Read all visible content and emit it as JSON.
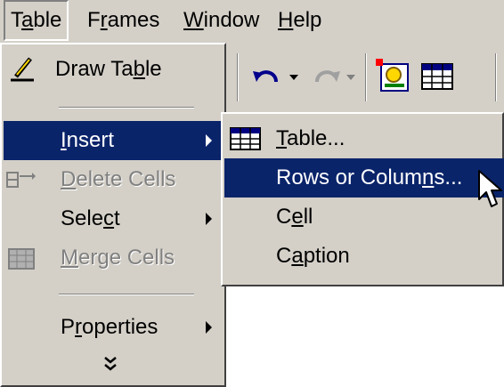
{
  "menubar": {
    "items": [
      {
        "pre": "T",
        "acc": "a",
        "post": "ble"
      },
      {
        "pre": "F",
        "acc": "r",
        "post": "ames"
      },
      {
        "pre": "",
        "acc": "W",
        "post": "indow"
      },
      {
        "pre": "",
        "acc": "H",
        "post": "elp"
      }
    ]
  },
  "table_menu": {
    "items": [
      {
        "pre": "Draw Ta",
        "acc": "b",
        "post": "le",
        "state": "normal",
        "icon": "pencil-icon"
      },
      {
        "pre": "",
        "acc": "I",
        "post": "nsert",
        "state": "highlighted",
        "submenu": true
      },
      {
        "pre": "",
        "acc": "D",
        "post": "elete Cells",
        "state": "disabled",
        "icon": "delete-cells-icon"
      },
      {
        "pre": "Sele",
        "acc": "c",
        "post": "t",
        "state": "normal",
        "submenu": true
      },
      {
        "pre": "",
        "acc": "M",
        "post": "erge Cells",
        "state": "disabled",
        "icon": "merge-cells-icon"
      },
      {
        "pre": "P",
        "acc": "r",
        "post": "operties",
        "state": "normal",
        "submenu": true
      }
    ],
    "expand_glyph": "»"
  },
  "insert_submenu": {
    "items": [
      {
        "pre": "",
        "acc": "T",
        "post": "able...",
        "state": "normal",
        "icon": "table-grid-icon"
      },
      {
        "pre": "Rows or Colum",
        "acc": "n",
        "post": "s...",
        "state": "highlighted"
      },
      {
        "pre": "C",
        "acc": "e",
        "post": "ll",
        "state": "normal"
      },
      {
        "pre": "C",
        "acc": "a",
        "post": "ption",
        "state": "normal"
      }
    ]
  },
  "colors": {
    "menu_bg": "#d4d0c8",
    "highlight": "#0a246a",
    "highlight_text": "#ffffff",
    "disabled_text": "#808080"
  }
}
